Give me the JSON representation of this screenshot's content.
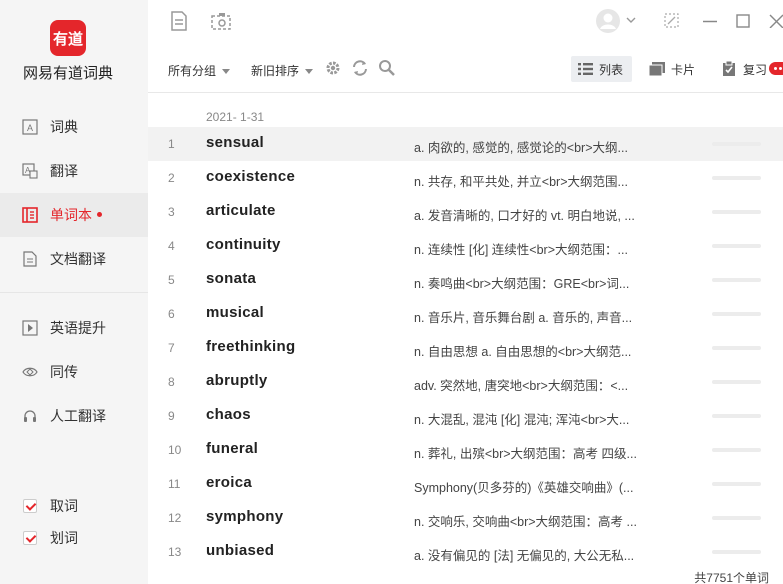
{
  "sidebar": {
    "logo_text": "有道",
    "app_name": "网易有道词典",
    "nav": [
      {
        "label": "词典",
        "icon": "dictionary-icon"
      },
      {
        "label": "翻译",
        "icon": "translate-icon"
      },
      {
        "label": "单词本",
        "icon": "wordbook-icon",
        "active": true
      },
      {
        "label": "文档翻译",
        "icon": "document-icon"
      },
      {
        "label": "英语提升",
        "icon": "play-icon"
      },
      {
        "label": "同传",
        "icon": "interpret-icon"
      },
      {
        "label": "人工翻译",
        "icon": "headset-icon"
      }
    ],
    "checks": [
      {
        "label": "取词",
        "checked": true
      },
      {
        "label": "划词",
        "checked": true
      }
    ]
  },
  "toolbar": {
    "group_filter": "所有分组",
    "sort": "新旧排序",
    "view_list": "列表",
    "view_card": "卡片",
    "review": "复习"
  },
  "list": {
    "date": "2021- 1-31",
    "rows": [
      {
        "n": "1",
        "word": "sensual",
        "def": "a. 肉欲的, 感觉的, 感觉论的<br>大纲..."
      },
      {
        "n": "2",
        "word": "coexistence",
        "def": "n. 共存, 和平共处, 并立<br>大纲范围..."
      },
      {
        "n": "3",
        "word": "articulate",
        "def": "a. 发音清晰的, 口才好的 vt. 明白地说, ..."
      },
      {
        "n": "4",
        "word": "continuity",
        "def": "n. 连续性 [化] 连续性<br>大纲范围：..."
      },
      {
        "n": "5",
        "word": "sonata",
        "def": "n. 奏鸣曲<br>大纲范围：GRE<br>词..."
      },
      {
        "n": "6",
        "word": "musical",
        "def": "n. 音乐片, 音乐舞台剧 a. 音乐的, 声音..."
      },
      {
        "n": "7",
        "word": "freethinking",
        "def": "n. 自由思想 a. 自由思想的<br>大纲范..."
      },
      {
        "n": "8",
        "word": "abruptly",
        "def": "adv. 突然地, 唐突地<br>大纲范围：<..."
      },
      {
        "n": "9",
        "word": "chaos",
        "def": "n. 大混乱, 混沌 [化] 混沌; 浑沌<br>大..."
      },
      {
        "n": "10",
        "word": "funeral",
        "def": "n. 葬礼, 出殡<br>大纲范围：高考 四级..."
      },
      {
        "n": "11",
        "word": "eroica",
        "def": "Symphony(贝多芬的)《英雄交响曲》(..."
      },
      {
        "n": "12",
        "word": "symphony",
        "def": "n. 交响乐, 交响曲<br>大纲范围：高考 ..."
      },
      {
        "n": "13",
        "word": "unbiased",
        "def": "a. 没有偏见的 [法] 无偏见的, 大公无私..."
      }
    ],
    "footer": "共7751个单词"
  },
  "colors": {
    "brand": "#e4262b",
    "sidebar_bg": "#f5f5f5"
  }
}
